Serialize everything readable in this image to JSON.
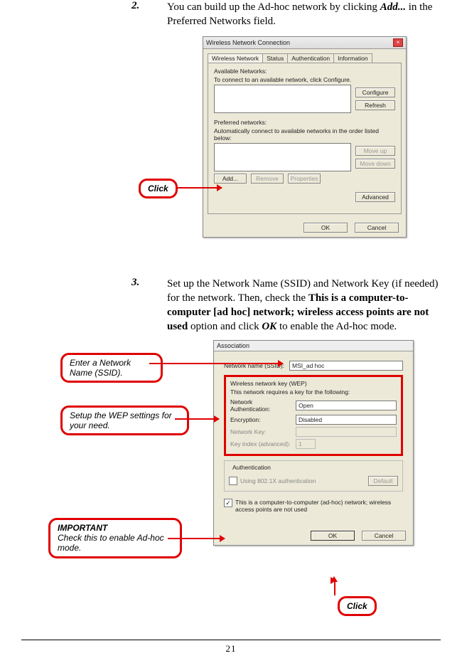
{
  "page_number": "21",
  "steps": {
    "s2": {
      "num": "2.",
      "prefix": "You can build up the Ad-hoc network by clicking ",
      "add": "Add...",
      "suffix": " in the Preferred Networks field."
    },
    "s3": {
      "num": "3.",
      "prefix": "Set up the Network Name (SSID) and Network Key (if needed) for the network.  Then, check the ",
      "bold": "This is a computer-to-computer [ad hoc] network; wireless access points are not used",
      "mid": " option and click ",
      "ok": "OK",
      "suffix": " to enable the Ad-hoc mode."
    }
  },
  "dialog1": {
    "title": "Wireless Network Connection",
    "tabs": [
      "Wireless Network",
      "Status",
      "Authentication",
      "Information"
    ],
    "avail_label": "Available Networks:",
    "avail_desc": "To connect to an available network, click Configure.",
    "btn_configure": "Configure",
    "btn_refresh": "Refresh",
    "pref_label": "Preferred networks:",
    "pref_desc": "Automatically connect to available networks in the order listed below:",
    "btn_moveup": "Move up",
    "btn_movedown": "Move down",
    "btn_add": "Add...",
    "btn_remove": "Remove",
    "btn_properties": "Properties",
    "btn_advanced": "Advanced",
    "btn_ok": "OK",
    "btn_cancel": "Cancel"
  },
  "dialog2": {
    "title": "Association",
    "ssid_label": "Network name (SSID):",
    "ssid_value": "MSI_ad hoc",
    "wep_title": "Wireless network key (WEP)",
    "wep_desc": "This network requires a key for the following:",
    "auth_label": "Network Authentication:",
    "auth_value": "Open",
    "enc_label": "Encryption:",
    "enc_value": "Disabled",
    "key_label": "Network Key:",
    "keyidx_label": "Key index (advanced):",
    "keyidx_value": "1",
    "auth_section": "Authentication",
    "use8021x": "Using 802.1X authentication",
    "default_btn": "Default",
    "adhoc_text": "This is a computer-to-computer (ad-hoc) network; wireless access points are not used",
    "btn_ok": "OK",
    "btn_cancel": "Cancel"
  },
  "callouts": {
    "click": "Click",
    "ssid": "Enter a Network Name (SSID).",
    "wep": "Setup the WEP settings for your need.",
    "imp_title": "IMPORTANT",
    "imp_text": "Check this to enable Ad-hoc mode.",
    "click2": "Click"
  }
}
